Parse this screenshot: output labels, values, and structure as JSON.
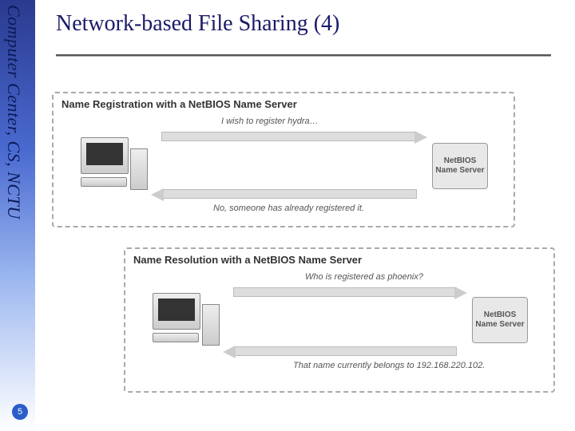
{
  "sidebar": {
    "label": "Computer Center, CS, NCTU"
  },
  "page_number": "5",
  "title": "Network-based File Sharing (4)",
  "diagrams": {
    "registration": {
      "title": "Name Registration with a NetBIOS Name Server",
      "request": "I wish to register hydra…",
      "response": "No, someone has already registered it.",
      "server_label": "NetBIOS Name Server"
    },
    "resolution": {
      "title": "Name Resolution with a NetBIOS Name Server",
      "request": "Who is registered as phoenix?",
      "response": "That name currently belongs to 192.168.220.102.",
      "server_label": "NetBIOS Name Server"
    }
  }
}
